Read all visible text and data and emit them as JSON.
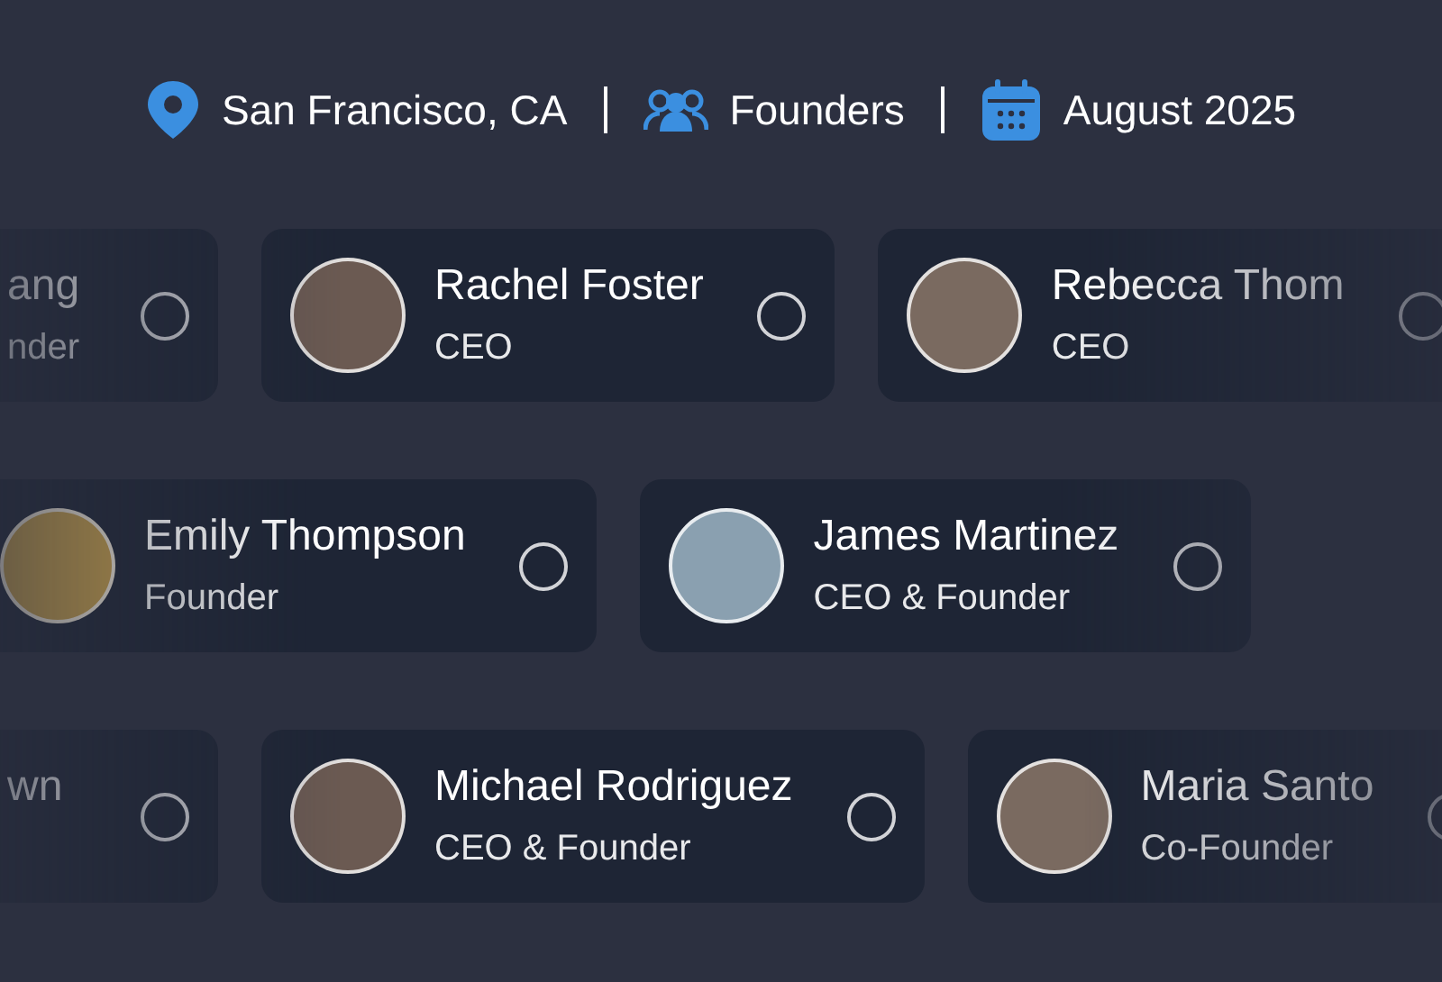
{
  "header": [
    {
      "kind": "location",
      "label": "San Francisco, CA"
    },
    {
      "kind": "people",
      "label": "Founders"
    },
    {
      "kind": "calendar",
      "label": "August 2025"
    }
  ],
  "rows": [
    {
      "cards": [
        {
          "kind": "clipped",
          "name": "ang",
          "role": "nder",
          "selected": false
        },
        {
          "kind": "full",
          "name": "Rachel Foster",
          "role": "CEO",
          "selected": false
        },
        {
          "kind": "full",
          "name": "Rebecca Thom",
          "role": "CEO",
          "selected": false
        }
      ]
    },
    {
      "cards": [
        {
          "kind": "full",
          "name": "Emily Thompson",
          "role": "Founder",
          "selected": false
        },
        {
          "kind": "full",
          "name": "James Martinez",
          "role": "CEO & Founder",
          "selected": false
        }
      ]
    },
    {
      "cards": [
        {
          "kind": "clipped",
          "name": "wn",
          "selected": false
        },
        {
          "kind": "full",
          "name": "Michael Rodriguez",
          "role": "CEO & Founder",
          "selected": false
        },
        {
          "kind": "full",
          "name": "Maria Santo",
          "role": "Co-Founder",
          "selected": false
        }
      ]
    }
  ]
}
